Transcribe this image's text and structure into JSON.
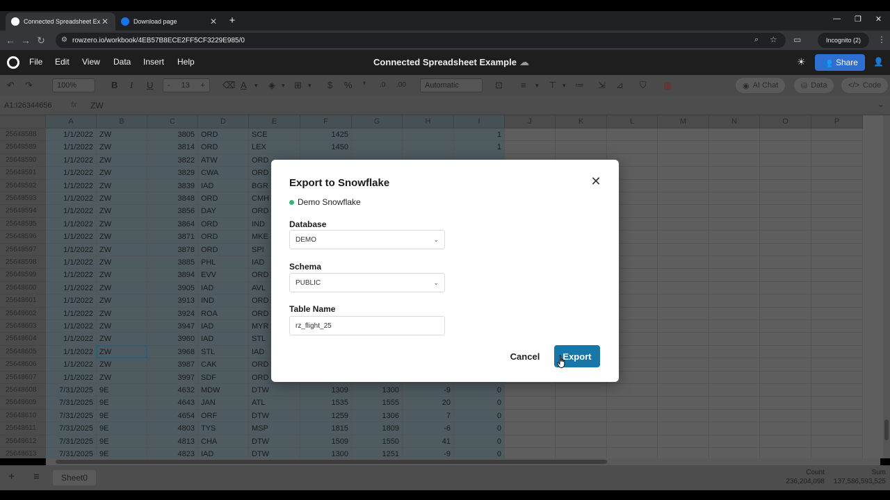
{
  "browser": {
    "tabs": [
      {
        "title": "Connected Spreadsheet Exampl",
        "active": true
      },
      {
        "title": "Download page",
        "active": false
      }
    ],
    "new_tab": "+",
    "url": "rowzero.io/workbook/4EB57B8ECE2FF5CF3229E985/0",
    "incognito": "Incognito (2)",
    "window_controls": [
      "—",
      "❐",
      "✕"
    ]
  },
  "app": {
    "menu": [
      "File",
      "Edit",
      "View",
      "Data",
      "Insert",
      "Help"
    ],
    "title": "Connected Spreadsheet Example",
    "share_label": "Share"
  },
  "toolbar": {
    "zoom": "100%",
    "bold": "B",
    "italic": "I",
    "underline": "U",
    "font_size": "13",
    "minus": "-",
    "plus": "+",
    "dollar": "$",
    "percent": "%",
    "format": "Automatic",
    "ai_chat": "AI Chat",
    "data": "Data",
    "code": "Code"
  },
  "formula_bar": {
    "cell_ref": "A1:I26344656",
    "fx": "fx",
    "value": "ZW"
  },
  "grid": {
    "columns": [
      "A",
      "B",
      "C",
      "D",
      "E",
      "F",
      "G",
      "H",
      "I",
      "J",
      "K",
      "L",
      "M",
      "N",
      "O",
      "P"
    ],
    "rows": [
      {
        "id": "25648588",
        "cells": [
          "1/1/2022",
          "ZW",
          "3805",
          "ORD",
          "SCE",
          "1425",
          "",
          "",
          "1"
        ]
      },
      {
        "id": "25648589",
        "cells": [
          "1/1/2022",
          "ZW",
          "3814",
          "ORD",
          "LEX",
          "1450",
          "",
          "",
          "1"
        ]
      },
      {
        "id": "25648590",
        "cells": [
          "1/1/2022",
          "ZW",
          "3822",
          "ATW",
          "ORD",
          "",
          "",
          "",
          ""
        ]
      },
      {
        "id": "25648591",
        "cells": [
          "1/1/2022",
          "ZW",
          "3829",
          "CWA",
          "ORD",
          "",
          "",
          "",
          ""
        ]
      },
      {
        "id": "25648592",
        "cells": [
          "1/1/2022",
          "ZW",
          "3839",
          "IAD",
          "BGR",
          "",
          "",
          "",
          ""
        ]
      },
      {
        "id": "25648593",
        "cells": [
          "1/1/2022",
          "ZW",
          "3848",
          "ORD",
          "CMH",
          "",
          "",
          "",
          ""
        ]
      },
      {
        "id": "25648594",
        "cells": [
          "1/1/2022",
          "ZW",
          "3856",
          "DAY",
          "ORD",
          "",
          "",
          "",
          ""
        ]
      },
      {
        "id": "25648595",
        "cells": [
          "1/1/2022",
          "ZW",
          "3864",
          "ORD",
          "IND",
          "",
          "",
          "",
          ""
        ]
      },
      {
        "id": "25648596",
        "cells": [
          "1/1/2022",
          "ZW",
          "3871",
          "ORD",
          "MKE",
          "",
          "",
          "",
          ""
        ]
      },
      {
        "id": "25648597",
        "cells": [
          "1/1/2022",
          "ZW",
          "3878",
          "ORD",
          "SPI",
          "",
          "",
          "",
          ""
        ]
      },
      {
        "id": "25648598",
        "cells": [
          "1/1/2022",
          "ZW",
          "3885",
          "PHL",
          "IAD",
          "",
          "",
          "",
          ""
        ]
      },
      {
        "id": "25648599",
        "cells": [
          "1/1/2022",
          "ZW",
          "3894",
          "EVV",
          "ORD",
          "",
          "",
          "",
          ""
        ]
      },
      {
        "id": "25648600",
        "cells": [
          "1/1/2022",
          "ZW",
          "3905",
          "IAD",
          "AVL",
          "",
          "",
          "",
          ""
        ]
      },
      {
        "id": "25648601",
        "cells": [
          "1/1/2022",
          "ZW",
          "3913",
          "IND",
          "ORD",
          "",
          "",
          "",
          ""
        ]
      },
      {
        "id": "25648602",
        "cells": [
          "1/1/2022",
          "ZW",
          "3924",
          "ROA",
          "ORD",
          "",
          "",
          "",
          ""
        ]
      },
      {
        "id": "25648603",
        "cells": [
          "1/1/2022",
          "ZW",
          "3947",
          "IAD",
          "MYR",
          "",
          "",
          "",
          ""
        ]
      },
      {
        "id": "25648604",
        "cells": [
          "1/1/2022",
          "ZW",
          "3960",
          "IAD",
          "STL",
          "",
          "",
          "",
          ""
        ]
      },
      {
        "id": "25648605",
        "cells": [
          "1/1/2022",
          "ZW",
          "3968",
          "STL",
          "IAD",
          "",
          "",
          "",
          ""
        ]
      },
      {
        "id": "25648606",
        "cells": [
          "1/1/2022",
          "ZW",
          "3987",
          "CAK",
          "ORD",
          "",
          "",
          "",
          ""
        ]
      },
      {
        "id": "25648607",
        "cells": [
          "1/1/2022",
          "ZW",
          "3997",
          "SDF",
          "ORD",
          "",
          "",
          "",
          ""
        ]
      },
      {
        "id": "25648608",
        "cells": [
          "7/31/2025",
          "9E",
          "4632",
          "MDW",
          "DTW",
          "1309",
          "1300",
          "-9",
          "0"
        ]
      },
      {
        "id": "25648609",
        "cells": [
          "7/31/2025",
          "9E",
          "4643",
          "JAN",
          "ATL",
          "1535",
          "1555",
          "20",
          "0"
        ]
      },
      {
        "id": "25648610",
        "cells": [
          "7/31/2025",
          "9E",
          "4654",
          "ORF",
          "DTW",
          "1259",
          "1306",
          "7",
          "0"
        ]
      },
      {
        "id": "25648611",
        "cells": [
          "7/31/2025",
          "9E",
          "4803",
          "TYS",
          "MSP",
          "1815",
          "1809",
          "-6",
          "0"
        ]
      },
      {
        "id": "25648612",
        "cells": [
          "7/31/2025",
          "9E",
          "4813",
          "CHA",
          "DTW",
          "1509",
          "1550",
          "41",
          "0"
        ]
      },
      {
        "id": "25648613",
        "cells": [
          "7/31/2025",
          "9E",
          "4823",
          "IAD",
          "DTW",
          "1300",
          "1251",
          "-9",
          "0"
        ]
      }
    ]
  },
  "sheet": {
    "tab": "Sheet0",
    "count_label": "Count",
    "count_value": "236,204,098",
    "sum_label": "Sum",
    "sum_value": "137,586,593,525"
  },
  "modal": {
    "title": "Export to Snowflake",
    "connection": "Demo Snowflake",
    "database_label": "Database",
    "database_value": "DEMO",
    "schema_label": "Schema",
    "schema_value": "PUBLIC",
    "table_label": "Table Name",
    "table_value": "rz_flight_25",
    "cancel_label": "Cancel",
    "export_label": "Export"
  },
  "colors": {
    "accent": "#1877a8",
    "share": "#2f6fd1",
    "connected": "#3cb371"
  }
}
